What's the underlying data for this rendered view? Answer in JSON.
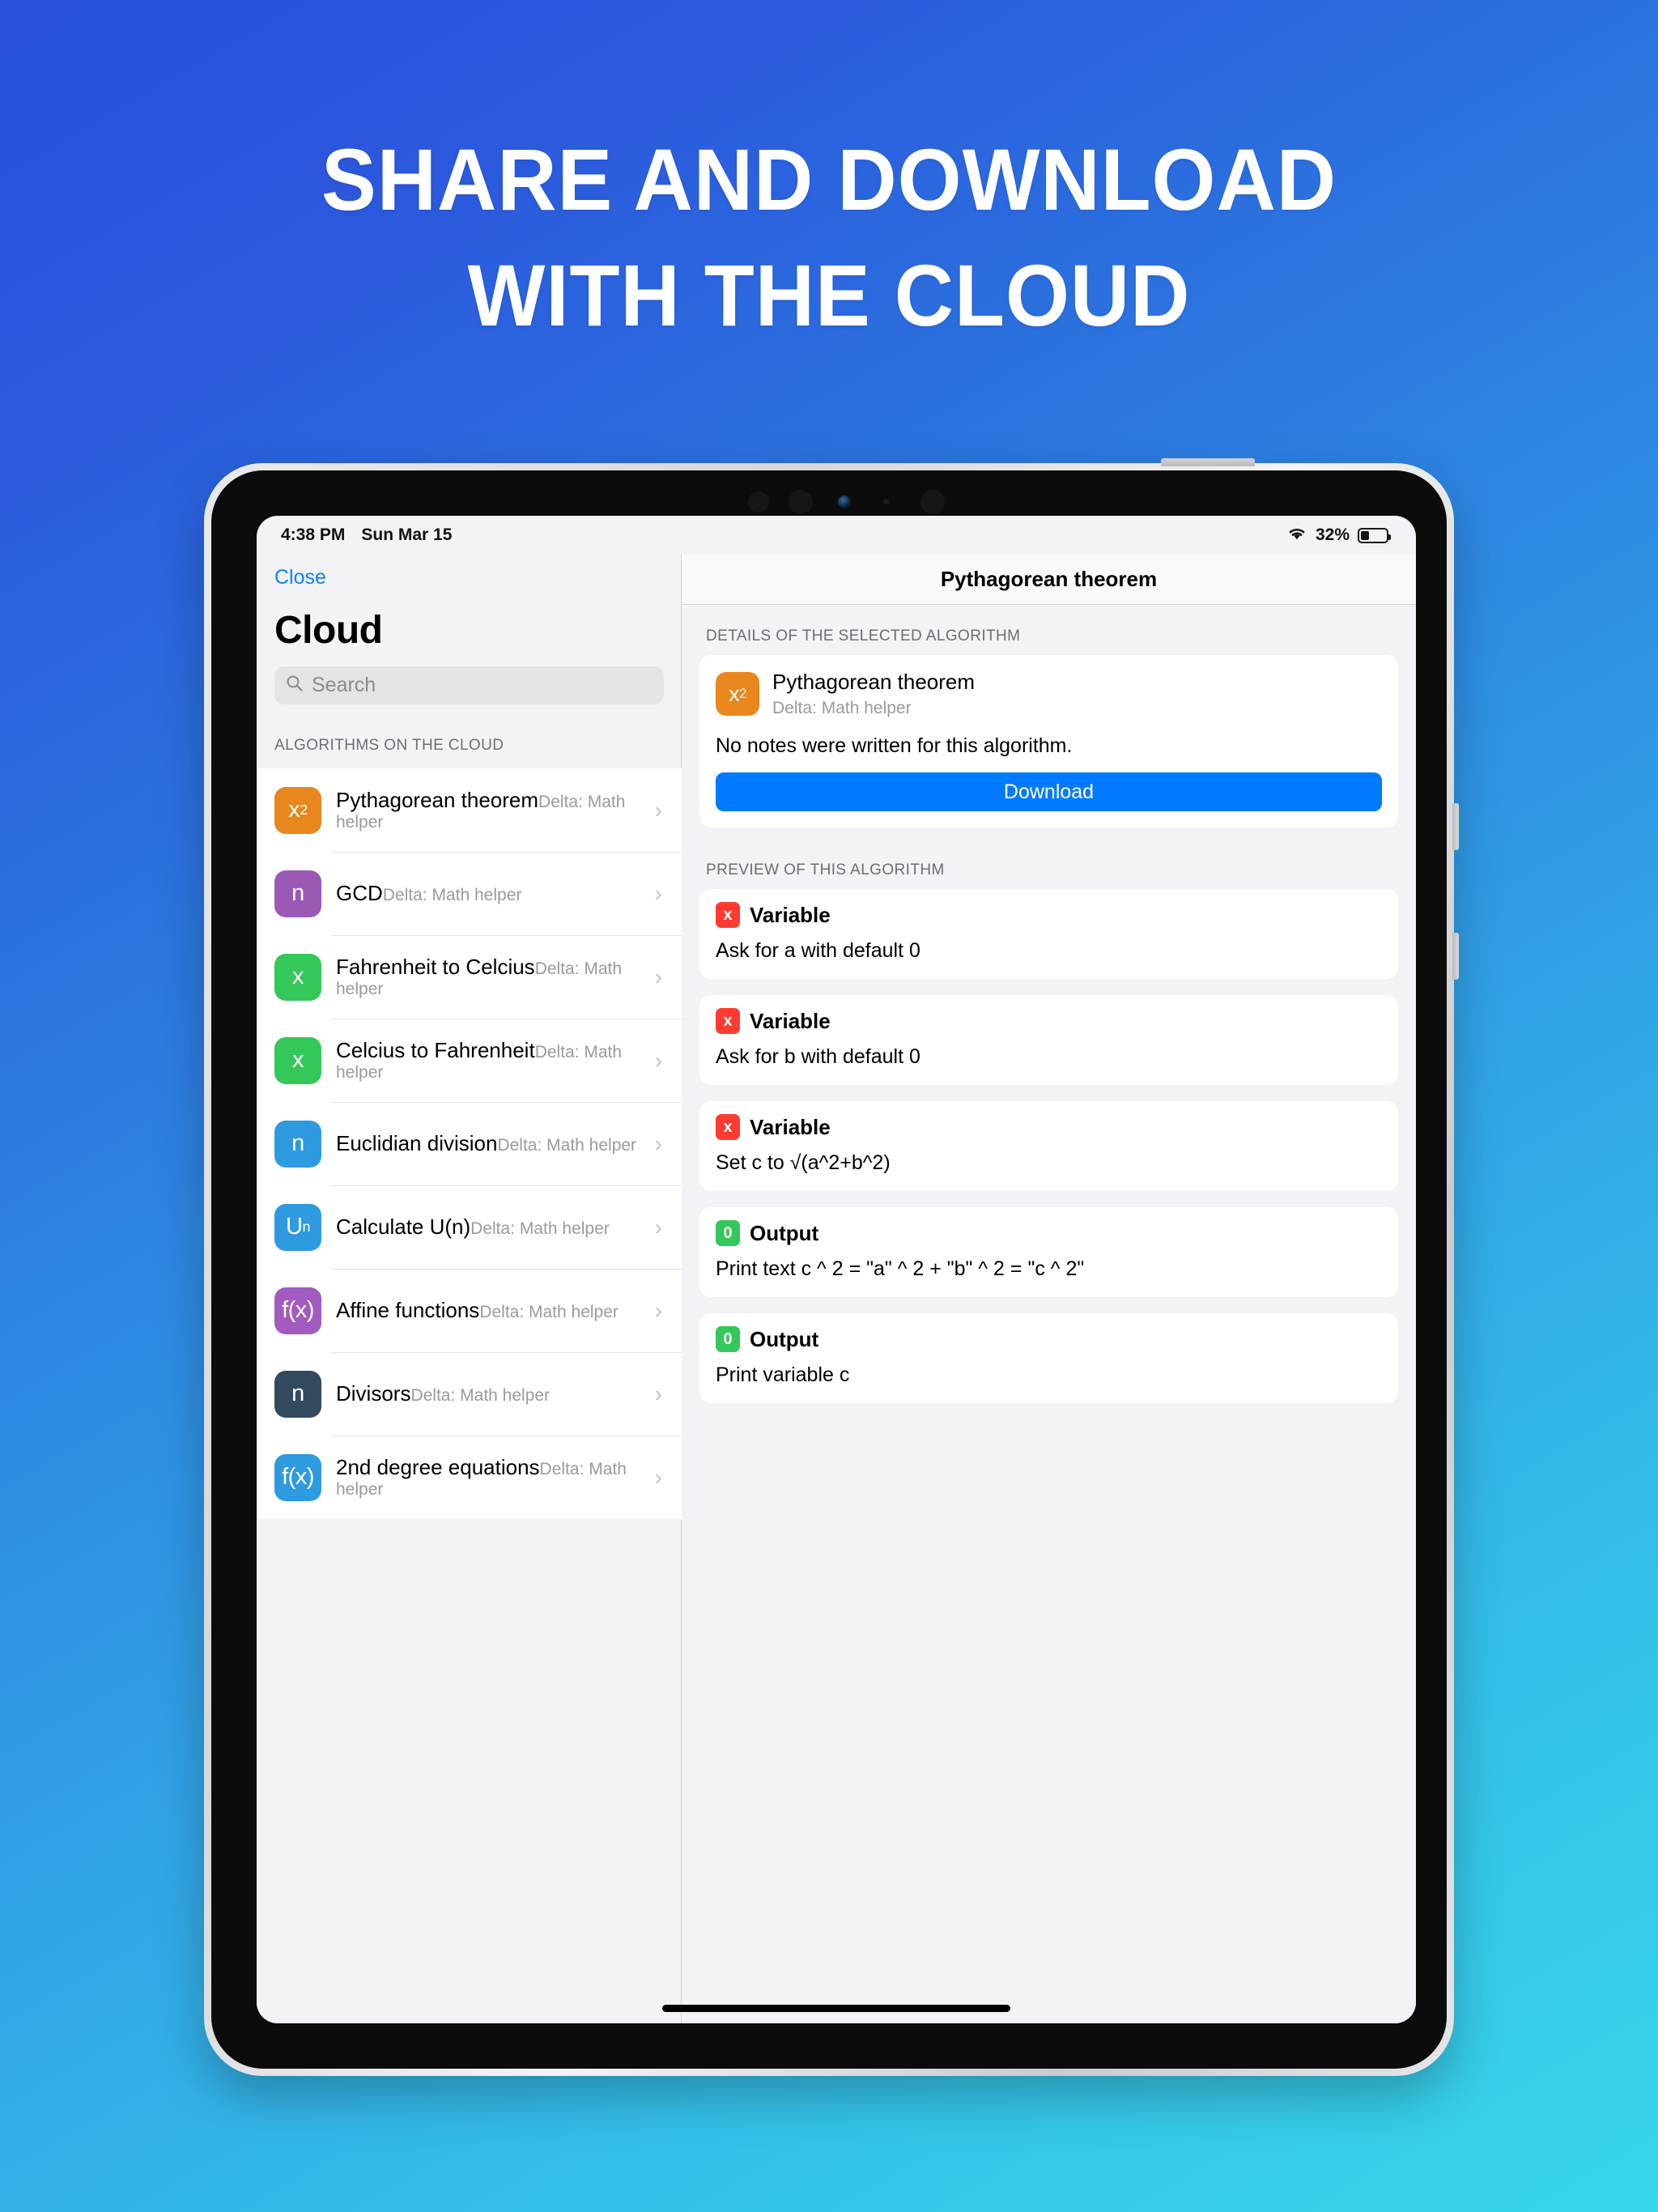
{
  "promo": {
    "line1": "SHARE AND DOWNLOAD",
    "line2": "WITH THE CLOUD"
  },
  "status_bar": {
    "time": "4:38 PM",
    "date": "Sun Mar 15",
    "battery_percent": "32%",
    "battery_level": 32,
    "wifi_icon": "wifi-icon",
    "battery_icon": "battery-icon"
  },
  "sidebar": {
    "close_label": "Close",
    "title": "Cloud",
    "search": {
      "placeholder": "Search",
      "value": "",
      "icon": "search-icon"
    },
    "section_header": "ALGORITHMS ON THE CLOUD",
    "items": [
      {
        "name": "Pythagorean theorem",
        "subtitle": "Delta: Math helper",
        "icon_glyph": "x2",
        "icon_color": "#e8871e",
        "selected": true
      },
      {
        "name": "GCD",
        "subtitle": "Delta: Math helper",
        "icon_glyph": "n",
        "icon_color": "#9b59b6",
        "selected": false
      },
      {
        "name": "Fahrenheit to Celcius",
        "subtitle": "Delta: Math helper",
        "icon_glyph": "x",
        "icon_color": "#34c759",
        "selected": false
      },
      {
        "name": "Celcius to Fahrenheit",
        "subtitle": "Delta: Math helper",
        "icon_glyph": "x",
        "icon_color": "#34c759",
        "selected": false
      },
      {
        "name": "Euclidian division",
        "subtitle": "Delta: Math helper",
        "icon_glyph": "n",
        "icon_color": "#2e9ae0",
        "selected": false
      },
      {
        "name": "Calculate U(n)",
        "subtitle": "Delta: Math helper",
        "icon_glyph": "Un",
        "icon_color": "#2e9ae0",
        "selected": false
      },
      {
        "name": "Affine functions",
        "subtitle": "Delta: Math helper",
        "icon_glyph": "f(x)",
        "icon_color": "#a35bbf",
        "selected": false
      },
      {
        "name": "Divisors",
        "subtitle": "Delta: Math helper",
        "icon_glyph": "n",
        "icon_color": "#33495e",
        "selected": false
      },
      {
        "name": "2nd degree equations",
        "subtitle": "Delta: Math helper",
        "icon_glyph": "f(x)",
        "icon_color": "#2e9ae0",
        "selected": false
      }
    ],
    "chevron_icon": "chevron-right-icon"
  },
  "detail": {
    "navbar_title": "Pythagorean theorem",
    "details_header": "DETAILS OF THE SELECTED ALGORITHM",
    "selected": {
      "name": "Pythagorean theorem",
      "subtitle": "Delta: Math helper",
      "icon_glyph": "x2",
      "icon_color": "#e8871e",
      "note": "No notes were written for this algorithm.",
      "download_label": "Download"
    },
    "preview_header": "PREVIEW OF THIS ALGORITHM",
    "steps": [
      {
        "type": "Variable",
        "badge": "x",
        "badge_color": "#ff3b30",
        "description": "Ask for a with default 0"
      },
      {
        "type": "Variable",
        "badge": "x",
        "badge_color": "#ff3b30",
        "description": "Ask for b with default 0"
      },
      {
        "type": "Variable",
        "badge": "x",
        "badge_color": "#ff3b30",
        "description": "Set c to √(a^2+b^2)"
      },
      {
        "type": "Output",
        "badge": "0",
        "badge_color": "#34c759",
        "description": "Print text c ^ 2 = \"a\" ^ 2 + \"b\" ^ 2 = \"c ^ 2\""
      },
      {
        "type": "Output",
        "badge": "0",
        "badge_color": "#34c759",
        "description": "Print variable c"
      }
    ]
  },
  "colors": {
    "accent_blue": "#007aff",
    "link_blue": "#0a84ff",
    "bg_gradient_start": "#2a50dd",
    "bg_gradient_end": "#38d6ea"
  }
}
